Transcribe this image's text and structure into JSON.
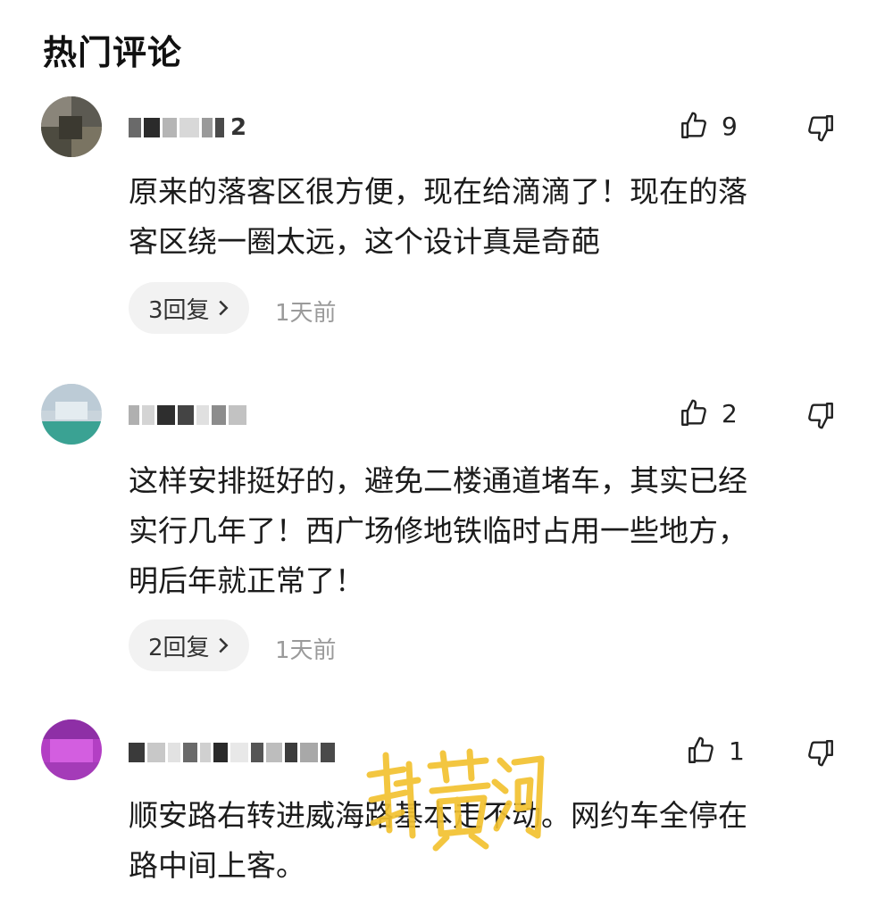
{
  "section": {
    "title": "热门评论"
  },
  "comments": [
    {
      "username_visible": "2",
      "likes": "9",
      "text_line1": "原来的落客区很方便，现在给滴滴了！现在的落",
      "text_line2": "客区绕一圈太远，这个设计真是奇葩",
      "text_line3": "",
      "replies": "3回复",
      "time": "1天前"
    },
    {
      "username_visible": "",
      "likes": "2",
      "text_line1": "这样安排挺好的，避免二楼通道堵车，其实已经",
      "text_line2": "实行几年了！西广场修地铁临时占用一些地方，",
      "text_line3": "明后年就正常了！",
      "replies": "2回复",
      "time": "1天前"
    },
    {
      "username_visible": "",
      "likes": "1",
      "text_line1": "顺安路右转进威海路基本走不动。网约车全停在",
      "text_line2": "路中间上客。",
      "text_line3": ""
    }
  ],
  "watermark": {
    "text": "新黄河"
  },
  "colors": {
    "pill_bg": "#f2f2f2",
    "time_gray": "#9a9a9a",
    "watermark_gold": "#f2c230"
  },
  "icons": {
    "like": "thumbs-up-icon",
    "dislike": "thumbs-down-icon",
    "chevron": "chevron-right-icon"
  }
}
